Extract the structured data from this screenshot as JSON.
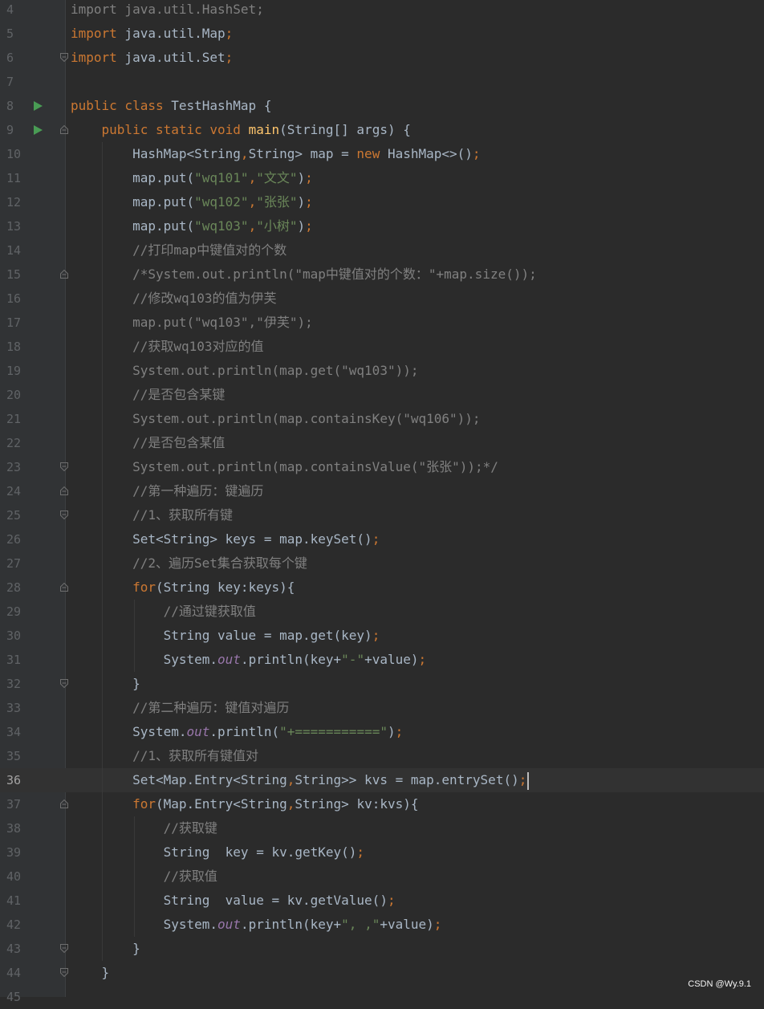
{
  "editor": {
    "language": "java",
    "current_line": 36,
    "watermark": "CSDN @Wy.9.1",
    "colors": {
      "background": "#2b2b2b",
      "gutter": "#313335",
      "keyword": "#cc7832",
      "string": "#6a8759",
      "comment": "#808080",
      "method_declaration": "#ffc66d",
      "static_field": "#9876aa",
      "default_text": "#a9b7c6",
      "run_marker": "#499c54"
    },
    "lines": [
      {
        "n": "4",
        "text": "import java.util.HashSet;"
      },
      {
        "n": "5",
        "text": "import java.util.Map;"
      },
      {
        "n": "6",
        "text": "import java.util.Set;"
      },
      {
        "n": "7",
        "text": ""
      },
      {
        "n": "8",
        "text": "public class TestHashMap {"
      },
      {
        "n": "9",
        "text": "    public static void main(String[] args) {"
      },
      {
        "n": "10",
        "text": "        HashMap<String,String> map = new HashMap<>();"
      },
      {
        "n": "11",
        "text": "        map.put(\"wq101\",\"文文\");"
      },
      {
        "n": "12",
        "text": "        map.put(\"wq102\",\"张张\");"
      },
      {
        "n": "13",
        "text": "        map.put(\"wq103\",\"小树\");"
      },
      {
        "n": "14",
        "text": "        //打印map中键值对的个数"
      },
      {
        "n": "15",
        "text": "        /*System.out.println(\"map中键值对的个数：\"+map.size());"
      },
      {
        "n": "16",
        "text": "        //修改wq103的值为伊芙"
      },
      {
        "n": "17",
        "text": "        map.put(\"wq103\",\"伊芙\");"
      },
      {
        "n": "18",
        "text": "        //获取wq103对应的值"
      },
      {
        "n": "19",
        "text": "        System.out.println(map.get(\"wq103\"));"
      },
      {
        "n": "20",
        "text": "        //是否包含某键"
      },
      {
        "n": "21",
        "text": "        System.out.println(map.containsKey(\"wq106\"));"
      },
      {
        "n": "22",
        "text": "        //是否包含某值"
      },
      {
        "n": "23",
        "text": "        System.out.println(map.containsValue(\"张张\"));*/"
      },
      {
        "n": "24",
        "text": "        //第一种遍历：键遍历"
      },
      {
        "n": "25",
        "text": "        //1、获取所有键"
      },
      {
        "n": "26",
        "text": "        Set<String> keys = map.keySet();"
      },
      {
        "n": "27",
        "text": "        //2、遍历Set集合获取每个键"
      },
      {
        "n": "28",
        "text": "        for(String key:keys){"
      },
      {
        "n": "29",
        "text": "            //通过键获取值"
      },
      {
        "n": "30",
        "text": "            String value = map.get(key);"
      },
      {
        "n": "31",
        "text": "            System.out.println(key+\"-\"+value);"
      },
      {
        "n": "32",
        "text": "        }"
      },
      {
        "n": "33",
        "text": "        //第二种遍历：键值对遍历"
      },
      {
        "n": "34",
        "text": "        System.out.println(\"+===========\");"
      },
      {
        "n": "35",
        "text": "        //1、获取所有键值对"
      },
      {
        "n": "36",
        "text": "        Set<Map.Entry<String,String>> kvs = map.entrySet();"
      },
      {
        "n": "37",
        "text": "        for(Map.Entry<String,String> kv:kvs){"
      },
      {
        "n": "38",
        "text": "            //获取键"
      },
      {
        "n": "39",
        "text": "            String  key = kv.getKey();"
      },
      {
        "n": "40",
        "text": "            //获取值"
      },
      {
        "n": "41",
        "text": "            String  value = kv.getValue();"
      },
      {
        "n": "42",
        "text": "            System.out.println(key+\", ,\"+value);"
      },
      {
        "n": "43",
        "text": "        }"
      },
      {
        "n": "44",
        "text": "    }"
      },
      {
        "n": "45",
        "text": ""
      }
    ]
  }
}
